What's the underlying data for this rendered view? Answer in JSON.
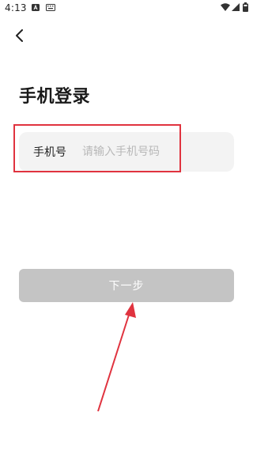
{
  "status_bar": {
    "time": "4:13"
  },
  "page": {
    "title": "手机登录"
  },
  "phone_field": {
    "label": "手机号",
    "placeholder": "请输入手机号码",
    "value": ""
  },
  "next_button": {
    "label": "下一步"
  },
  "colors": {
    "annotation_red": "#e0333f",
    "button_disabled": "#c4c4c4",
    "field_bg": "#f3f3f3"
  }
}
